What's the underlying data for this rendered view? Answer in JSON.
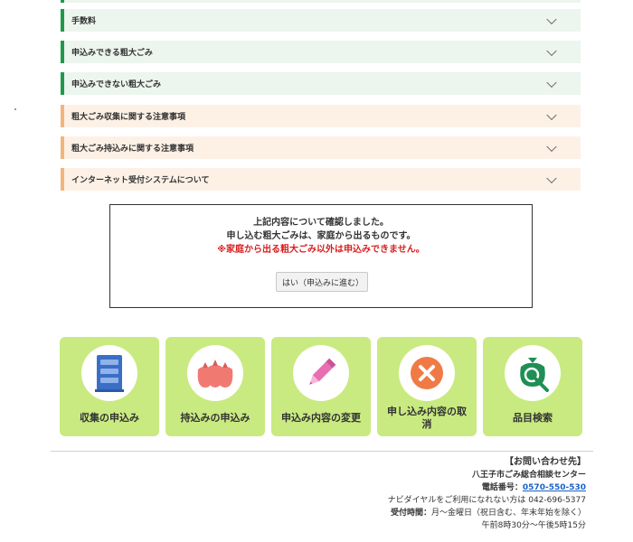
{
  "accordion": [
    {
      "label": "手数料",
      "style": "green"
    },
    {
      "label": "申込みできる粗大ごみ",
      "style": "green"
    },
    {
      "label": "申込みできない粗大ごみ",
      "style": "green"
    },
    {
      "label": "粗大ごみ収集に関する注意事項",
      "style": "orange"
    },
    {
      "label": "粗大ごみ持込みに関する注意事項",
      "style": "orange"
    },
    {
      "label": "インターネット受付システムについて",
      "style": "orange"
    }
  ],
  "confirm": {
    "line1": "上記内容について確認しました。",
    "line2": "申し込む粗大ごみは、家庭から出るものです。",
    "line3": "※家庭から出る粗大ごみ以外は申込みできません。",
    "button": "はい（申込みに進む）"
  },
  "tiles": [
    {
      "label": "収集の申込み",
      "icon": "building-icon"
    },
    {
      "label": "持込みの申込み",
      "icon": "garbage-bags-icon"
    },
    {
      "label": "申込み内容の変更",
      "icon": "pencil-icon"
    },
    {
      "label": "申し込み内容の取消",
      "icon": "cancel-icon"
    },
    {
      "label": "品目検索",
      "icon": "search-bag-icon"
    }
  ],
  "contact": {
    "heading": "【お問い合わせ先】",
    "org": "八王子市ごみ総合相談センター",
    "phone_label": "電話番号：",
    "phone": "0570-550-530",
    "navi": "ナビダイヤルをご利用になれない方は 042-696-5377",
    "hours_label": "受付時間：",
    "hours": "月～金曜日（祝日含む、年末年始を除く）",
    "hours2": "午前8時30分～午後5時15分"
  },
  "colors": {
    "green_accent": "#1e9a4a",
    "orange_accent": "#f3b47d",
    "tile_bg": "#c9ea80",
    "warning_red": "#d81e1e",
    "link_blue": "#1a62c8"
  }
}
